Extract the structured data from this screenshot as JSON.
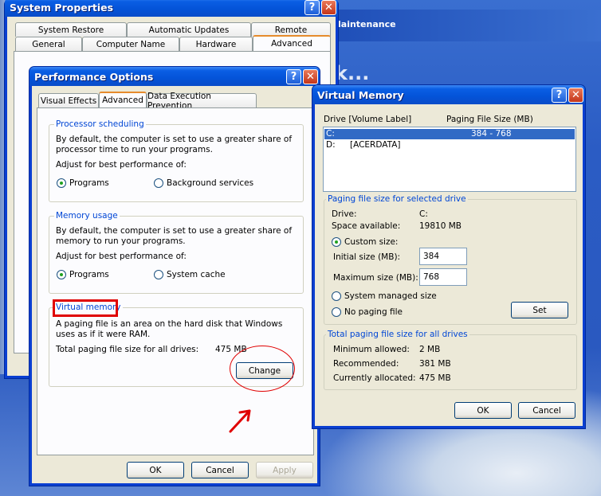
{
  "background": {
    "bg_title": "laintenance",
    "bg_dots": "k..."
  },
  "system_properties": {
    "title": "System Properties",
    "tabs_row1": [
      "System Restore",
      "Automatic Updates",
      "Remote"
    ],
    "tabs_row2": [
      "General",
      "Computer Name",
      "Hardware",
      "Advanced"
    ]
  },
  "performance_options": {
    "title": "Performance Options",
    "tabs": [
      "Visual Effects",
      "Advanced",
      "Data Execution Prevention"
    ],
    "processor": {
      "label": "Processor scheduling",
      "desc": "By default, the computer is set to use a greater share of processor time to run your programs.",
      "adjust": "Adjust for best performance of:",
      "opt1": "Programs",
      "opt2": "Background services"
    },
    "memory": {
      "label": "Memory usage",
      "desc": "By default, the computer is set to use a greater share of memory to run your programs.",
      "adjust": "Adjust for best performance of:",
      "opt1": "Programs",
      "opt2": "System cache"
    },
    "virtual": {
      "label": "Virtual memory",
      "desc": "A paging file is an area on the hard disk that Windows uses as if it were RAM.",
      "total_label": "Total paging file size for all drives:",
      "total_value": "475 MB",
      "change": "Change"
    },
    "ok": "OK",
    "cancel": "Cancel",
    "apply": "Apply"
  },
  "virtual_memory": {
    "title": "Virtual Memory",
    "col_drive": "Drive  [Volume Label]",
    "col_size": "Paging File Size (MB)",
    "drives": [
      {
        "drive": "C:",
        "label": "",
        "size": "384 - 768"
      },
      {
        "drive": "D:",
        "label": "[ACERDATA]",
        "size": ""
      }
    ],
    "selected": {
      "label": "Paging file size for selected drive",
      "drive_label": "Drive:",
      "drive_value": "C:",
      "space_label": "Space available:",
      "space_value": "19810 MB",
      "custom": "Custom size:",
      "initial_label": "Initial size (MB):",
      "initial_value": "384",
      "max_label": "Maximum size (MB):",
      "max_value": "768",
      "system_managed": "System managed size",
      "no_paging": "No paging file",
      "set": "Set"
    },
    "total": {
      "label": "Total paging file size for all drives",
      "min_label": "Minimum allowed:",
      "min_value": "2 MB",
      "rec_label": "Recommended:",
      "rec_value": "381 MB",
      "cur_label": "Currently allocated:",
      "cur_value": "475 MB"
    },
    "ok": "OK",
    "cancel": "Cancel"
  }
}
